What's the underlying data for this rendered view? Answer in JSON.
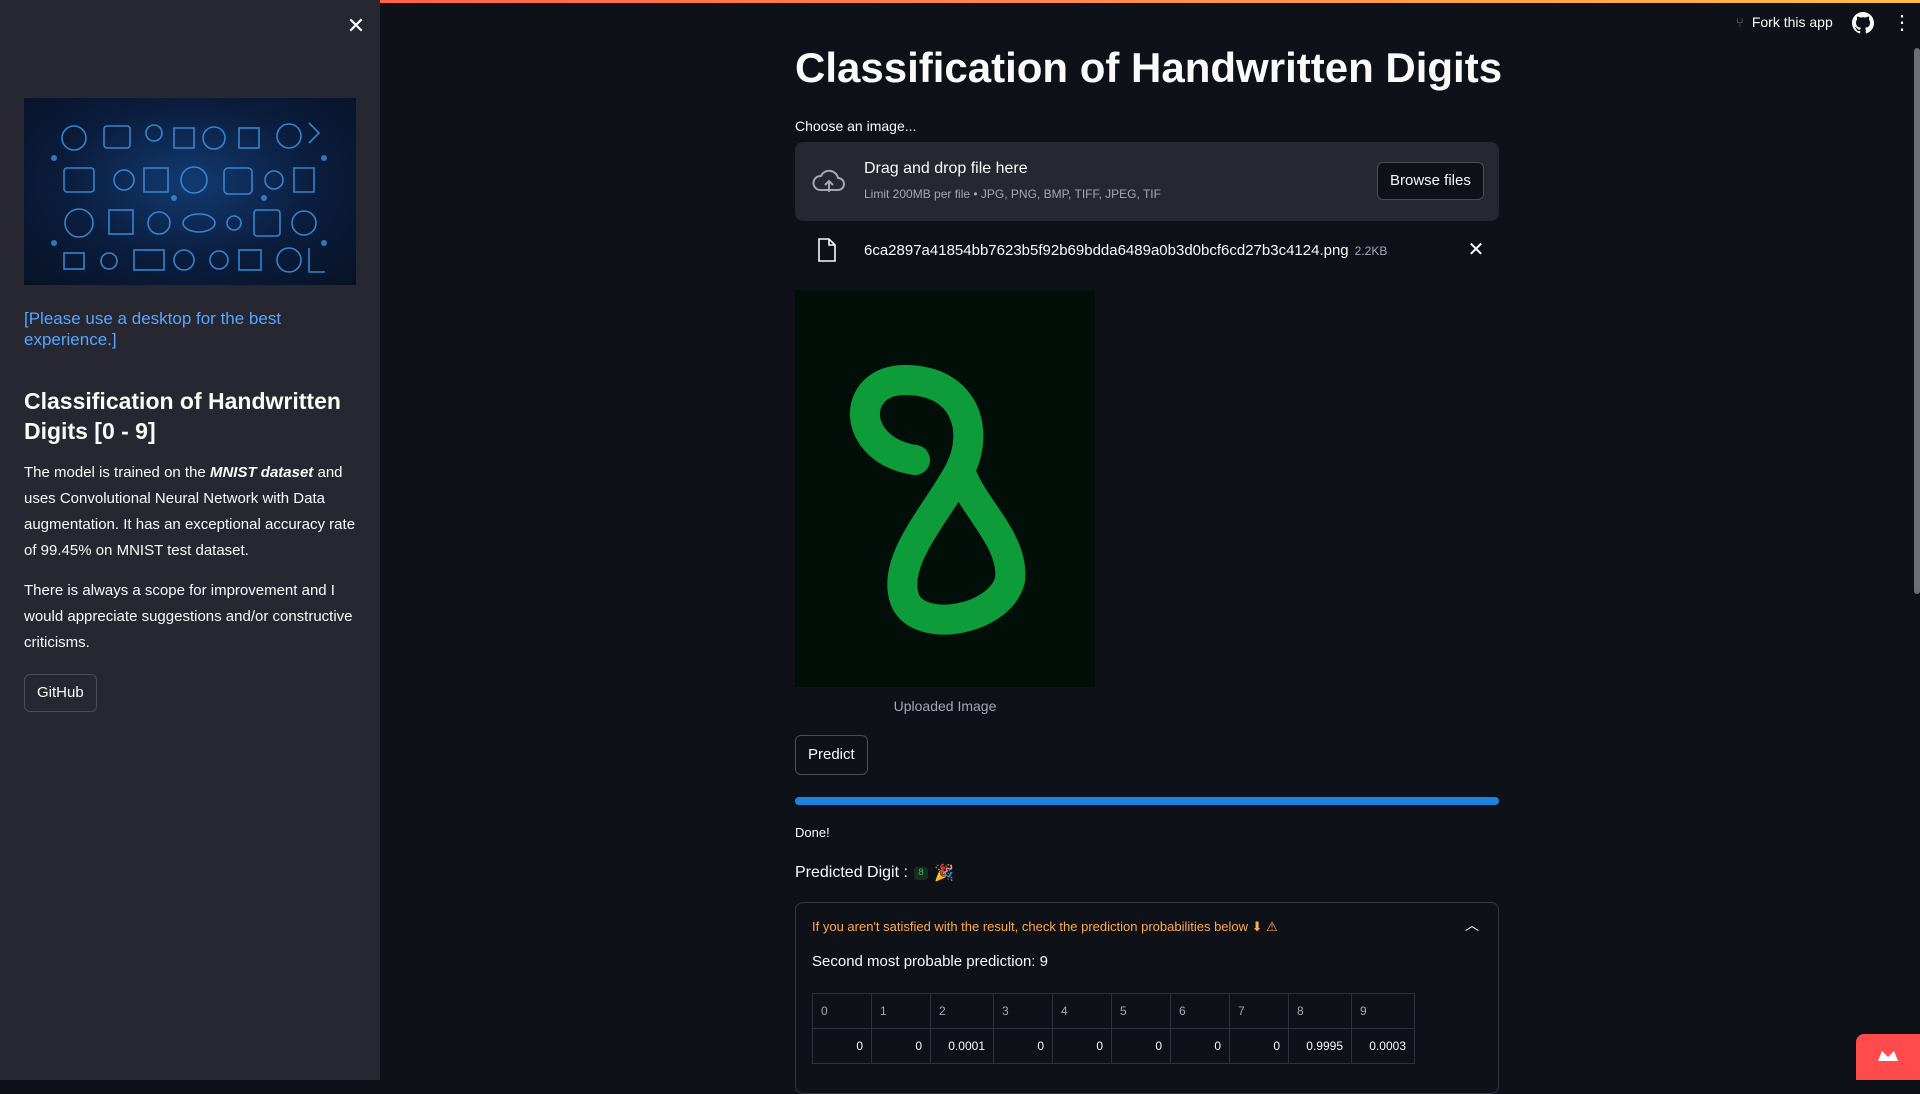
{
  "sidebar": {
    "close_icon": "close-icon",
    "link_text": "[Please use a desktop for the best experience.]",
    "title": "Classification of Handwritten Digits [0 - 9]",
    "para1_pre": "The model is trained on the ",
    "para1_em": "MNIST dataset",
    "para1_post": " and uses Convolutional Neural Network with Data augmentation. It has an exceptional accuracy rate of 99.45% on MNIST test dataset.",
    "para2": "There is always a scope for improvement and I would appreciate suggestions and/or constructive criticisms.",
    "github_label": "GitHub"
  },
  "header": {
    "fork_label": "Fork this app"
  },
  "main": {
    "title": "Classification of Handwritten Digits",
    "uploader_label": "Choose an image...",
    "dropzone_text": "Drag and drop file here",
    "dropzone_limit": "Limit 200MB per file • JPG, PNG, BMP, TIFF, JPEG, TIF",
    "browse_label": "Browse files",
    "file_name": "6ca2897a41854bb7623b5f92b69bdda6489a0b3d0bcf6cd27b3c4124.png",
    "file_size": "2.2KB",
    "image_caption": "Uploaded Image",
    "predict_label": "Predict",
    "progress": 1.0,
    "done_text": "Done!",
    "predicted_label": "Predicted Digit :",
    "predicted_value": "8",
    "expander_text": "If you aren't satisfied with the result, check the prediction probabilities below ⬇ ⚠",
    "second_text": "Second most probable prediction: 9",
    "prob_headers": [
      "0",
      "1",
      "2",
      "3",
      "4",
      "5",
      "6",
      "7",
      "8",
      "9"
    ],
    "prob_values": [
      "0",
      "0",
      "0.0001",
      "0",
      "0",
      "0",
      "0",
      "0",
      "0.9995",
      "0.0003"
    ]
  },
  "colors": {
    "accent": "#1c83e1",
    "link": "#58a6ff",
    "warning": "#ffa94d",
    "digit_stroke": "#0e9b3a"
  }
}
